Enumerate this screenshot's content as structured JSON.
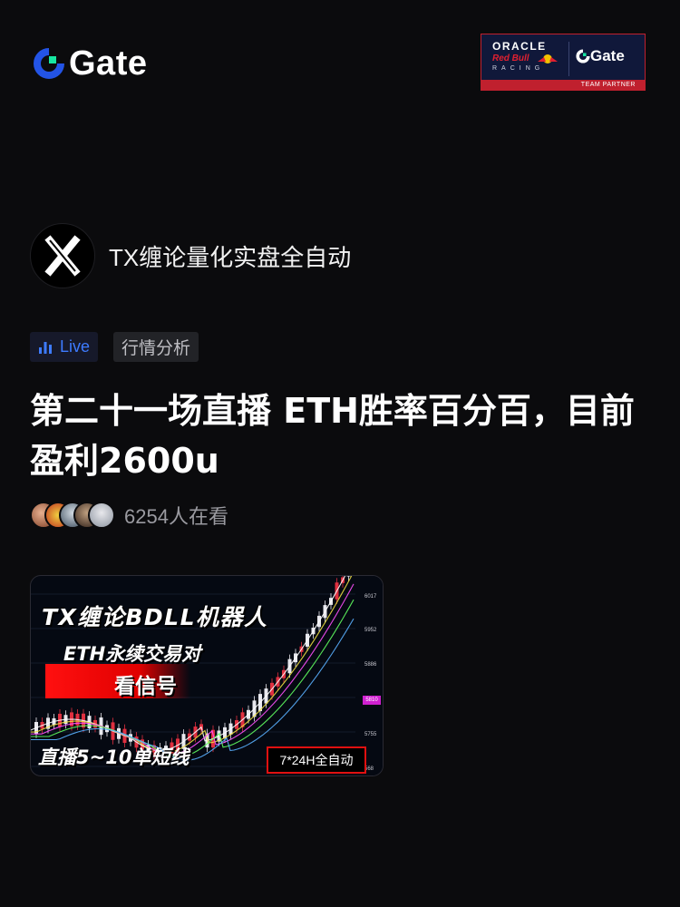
{
  "brand": {
    "name": "Gate",
    "accent": "#2354e6",
    "accent_green": "#17e6a1"
  },
  "partner": {
    "line1": "ORACLE",
    "line2": "Red Bull",
    "line3": "RACING",
    "brand": "Gate",
    "label": "TEAM PARTNER"
  },
  "channel": {
    "name": "TX缠论量化实盘全自动",
    "avatar_icon": "x-logo-icon"
  },
  "tags": {
    "live_label": "Live",
    "category": "行情分析",
    "live_icon": "bar-chart-icon"
  },
  "stream": {
    "title": "第二十一场直播 ETH胜率百分百，目前盈利2600u",
    "viewer_count": "6254人在看"
  },
  "thumbnail": {
    "headline": "TX缠论BDLL机器人",
    "subline": "ETH永续交易对",
    "signal": "看信号",
    "bottom": "直播5~10单短线",
    "box": "7*24H全自动",
    "scale_top": "6017",
    "scale_1": "5952",
    "scale_2": "5886",
    "scale_marker": "5810",
    "scale_3": "5755",
    "scale_4": "568"
  }
}
